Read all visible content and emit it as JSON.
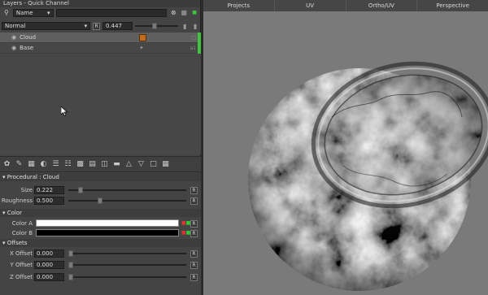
{
  "panel": {
    "title": "Layers - Quick Channel",
    "filter_select": "Name",
    "blend_mode": "Normal",
    "r_label": "R",
    "opacity": "0.447",
    "opacity_fraction": 0.447
  },
  "layers": [
    {
      "name": "Cloud",
      "trail": "",
      "active": true
    },
    {
      "name": "Base",
      "trail": "a1",
      "active": false
    }
  ],
  "props": {
    "procedural_title": "Procedural : Cloud",
    "size_label": "Size",
    "size_value": "0.222",
    "roughness_label": "Roughness",
    "roughness_value": "0.500",
    "color_title": "Color",
    "color_a_label": "Color A",
    "color_a": "#ffffff",
    "color_b_label": "Color B",
    "color_b": "#000000",
    "offsets_title": "Offsets",
    "x_offset_label": "X Offset",
    "x_offset_value": "0.000",
    "y_offset_label": "Y Offset",
    "y_offset_value": "0.000",
    "z_offset_label": "Z Offset",
    "z_offset_value": "0.000",
    "r_label": "R"
  },
  "tabs": [
    "Projects",
    "UV",
    "Ortho/UV",
    "Perspective"
  ],
  "colors": {
    "active_marker": "#3fc43f",
    "viewport_bg": "#7a7a7a"
  }
}
